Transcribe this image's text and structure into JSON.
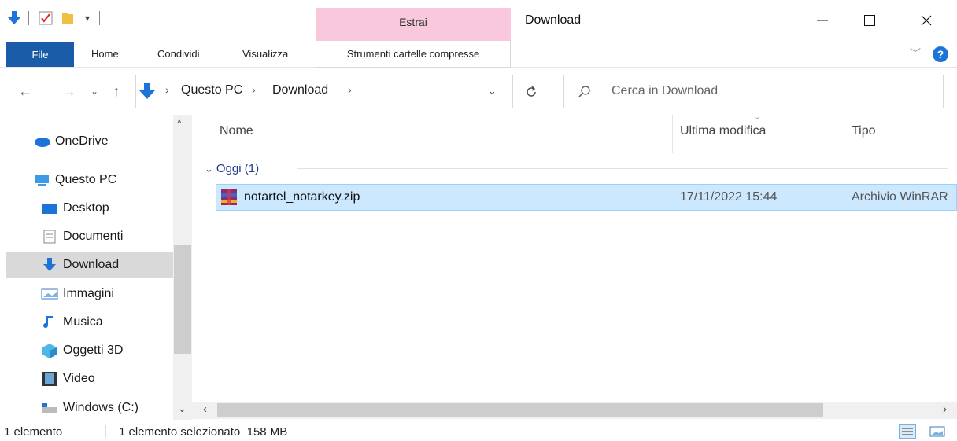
{
  "titlebar": {
    "context_tab_label": "Estrai",
    "window_title": "Download",
    "minimize_icon": "minimize-icon",
    "maximize_icon": "maximize-icon",
    "close_icon": "close-icon"
  },
  "ribbon": {
    "file_label": "File",
    "tabs": [
      "Home",
      "Condividi",
      "Visualizza"
    ],
    "tools_tab_label": "Strumenti cartelle compresse"
  },
  "address": {
    "crumbs": [
      "Questo PC",
      "Download"
    ],
    "search_placeholder": "Cerca in Download"
  },
  "nav": {
    "items": [
      {
        "label": "OneDrive",
        "icon": "cloud-icon"
      },
      {
        "label": "Questo PC",
        "icon": "computer-icon"
      },
      {
        "label": "Desktop",
        "icon": "desktop-icon"
      },
      {
        "label": "Documenti",
        "icon": "document-icon"
      },
      {
        "label": "Download",
        "icon": "download-icon"
      },
      {
        "label": "Immagini",
        "icon": "image-icon"
      },
      {
        "label": "Musica",
        "icon": "music-icon"
      },
      {
        "label": "Oggetti 3D",
        "icon": "cube-icon"
      },
      {
        "label": "Video",
        "icon": "video-icon"
      },
      {
        "label": "Windows  (C:)",
        "icon": "drive-icon"
      }
    ]
  },
  "columns": {
    "name": "Nome",
    "modified": "Ultima modifica",
    "type": "Tipo"
  },
  "group": {
    "label": "Oggi (1)"
  },
  "files": [
    {
      "name": "notartel_notarkey.zip",
      "modified": "17/11/2022 15:44",
      "type": "Archivio WinRAR"
    }
  ],
  "status": {
    "count": "1 elemento",
    "selection": "1 elemento selezionato  158 MB"
  },
  "colors": {
    "accent": "#1a5ca8",
    "context_tab": "#f9c8dc",
    "selection": "#cce8ff"
  }
}
